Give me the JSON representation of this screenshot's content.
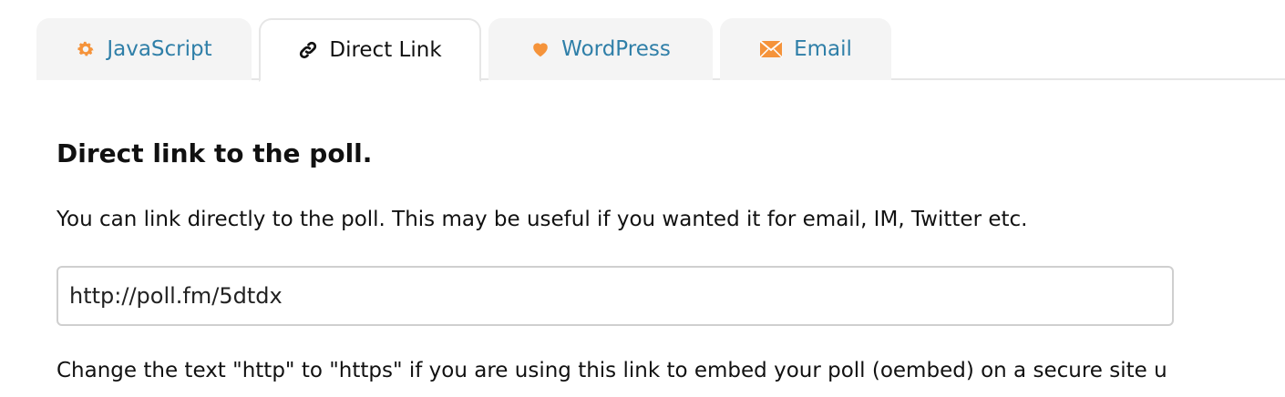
{
  "tabs": [
    {
      "label": "JavaScript",
      "icon": "gear-icon",
      "active": false
    },
    {
      "label": "Direct Link",
      "icon": "link-icon",
      "active": true
    },
    {
      "label": "WordPress",
      "icon": "heart-icon",
      "active": false
    },
    {
      "label": "Email",
      "icon": "envelope-icon",
      "active": false
    }
  ],
  "colors": {
    "tab_link": "#2f7fa8",
    "icon_orange": "#f5933a",
    "tab_bg": "#f4f4f4"
  },
  "main": {
    "heading": "Direct link to the poll.",
    "description": "You can link directly to the poll. This may be useful if you wanted it for email, IM, Twitter etc.",
    "url_value": "http://poll.fm/5dtdx",
    "note": "Change the text \"http\" to \"https\" if you are using this link to embed your poll (oembed) on a secure site u"
  }
}
